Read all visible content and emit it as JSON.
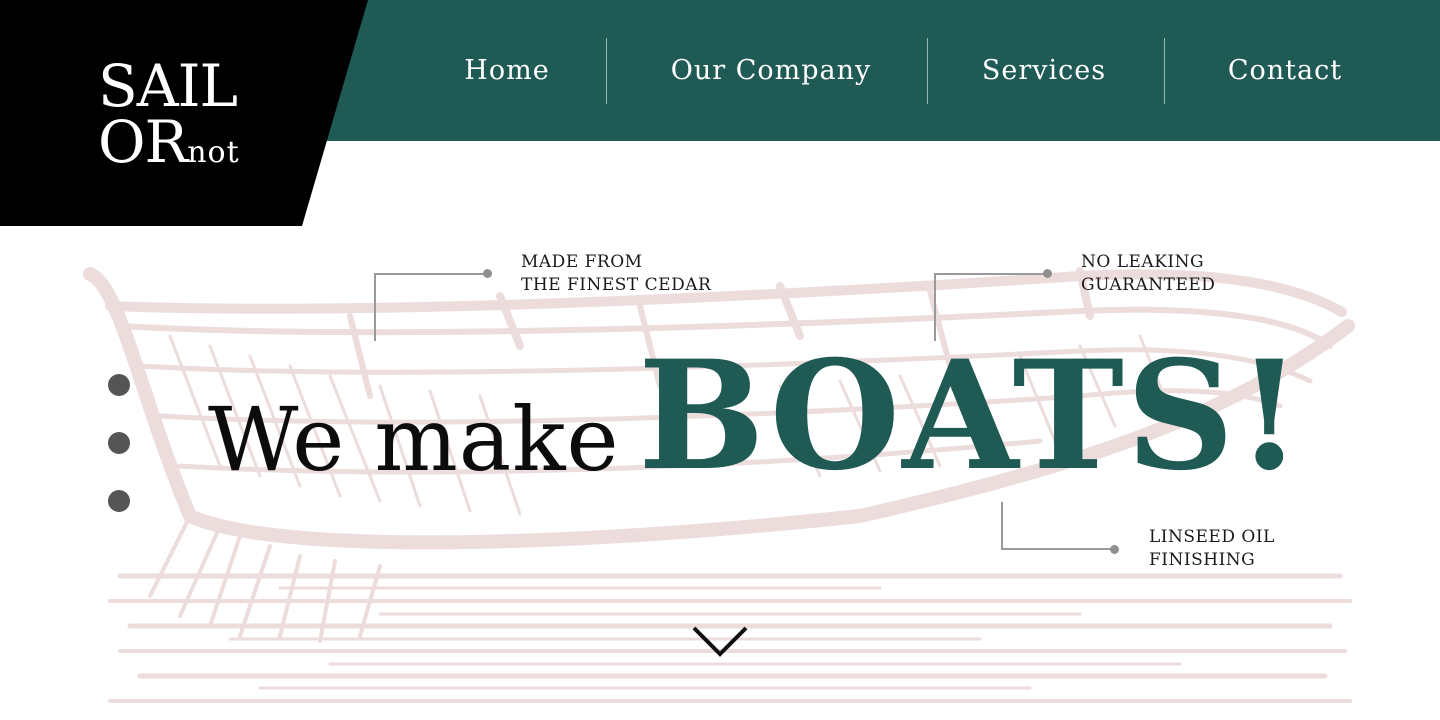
{
  "brand": {
    "line1": "SAIL",
    "line2": "OR",
    "suffix": "not"
  },
  "nav": {
    "items": [
      {
        "label": "Home"
      },
      {
        "label": "Our Company"
      },
      {
        "label": "Services"
      },
      {
        "label": "Contact"
      }
    ]
  },
  "callouts": [
    {
      "line1": "MADE FROM",
      "line2": "THE FINEST CEDAR"
    },
    {
      "line1": "NO LEAKING",
      "line2": "GUARANTEED"
    },
    {
      "line1": "LINSEED OIL",
      "line2": "FINISHING"
    }
  ],
  "hero": {
    "headline_prefix": "We make",
    "headline_emphasis": "BOATS!"
  },
  "slider": {
    "dot_count": 3
  },
  "icons": {
    "scroll": "chevron-down-icon",
    "background": "boat-illustration"
  },
  "colors": {
    "primary": "#1f5a54",
    "logo_bg": "#000000",
    "illustration": "#ecdcdc",
    "dots": "#555555",
    "callout_line": "#9a9a9a"
  }
}
